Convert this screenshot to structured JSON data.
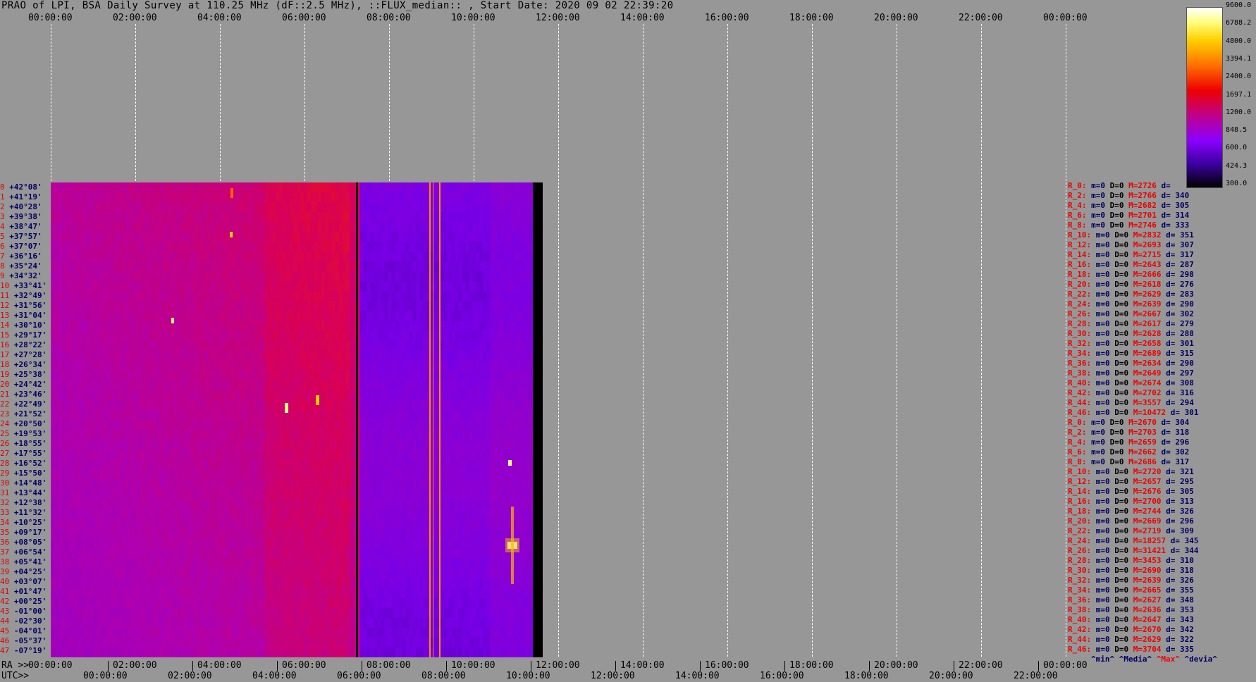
{
  "title": "PRAO of LPI, BSA Daily Survey at 110.25 MHz (dF::2.5 MHz), ::FLUX_median:: , Start Date: 2020 09 02 22:39:20",
  "top_axis_labels": [
    "00:00:00",
    "02:00:00",
    "04:00:00",
    "06:00:00",
    "08:00:00",
    "10:00:00",
    "12:00:00",
    "14:00:00",
    "16:00:00",
    "18:00:00",
    "20:00:00",
    "22:00:00",
    "00:00:00"
  ],
  "ra_prefix": "RA >>",
  "utc_prefix": "UTC>>",
  "ra_axis_labels": [
    "00:00:00",
    "02:00:00",
    "04:00:00",
    "06:00:00",
    "08:00:00",
    "10:00:00",
    "12:00:00",
    "14:00:00",
    "16:00:00",
    "18:00:00",
    "20:00:00",
    "22:00:00",
    "00:00:00"
  ],
  "utc_axis_labels": [
    "00:00:00",
    "02:00:00",
    "04:00:00",
    "06:00:00",
    "08:00:00",
    "10:00:00",
    "12:00:00",
    "14:00:00",
    "16:00:00",
    "18:00:00",
    "20:00:00",
    "22:00:00"
  ],
  "colorbar_ticks": [
    "9600.0",
    "6788.2",
    "4800.0",
    "3394.1",
    "2400.0",
    "1697.1",
    "1200.0",
    "848.5",
    "600.0",
    "424.3",
    "300.0"
  ],
  "legend": {
    "min": "^min^",
    "median": "^Media^",
    "max": "^Max^",
    "dev": "^devia^"
  },
  "declinations": [
    "+42°08'",
    "+41°19'",
    "+40°28'",
    "+39°38'",
    "+38°47'",
    "+37°57'",
    "+37°07'",
    "+36°16'",
    "+35°24'",
    "+34°32'",
    "+33°41'",
    "+32°49'",
    "+31°56'",
    "+31°04'",
    "+30°10'",
    "+29°17'",
    "+28°22'",
    "+27°28'",
    "+26°34'",
    "+25°38'",
    "+24°42'",
    "+23°46'",
    "+22°49'",
    "+21°52'",
    "+20°50'",
    "+19°53'",
    "+18°55'",
    "+17°55'",
    "+16°52'",
    "+15°50'",
    "+14°48'",
    "+13°44'",
    "+12°38'",
    "+11°32'",
    "+10°25'",
    "+09°17'",
    "+08°05'",
    "+06°54'",
    "+05°41'",
    "+04°25'",
    "+03°07'",
    "+01°47'",
    "+00°25'",
    "-01°00'",
    "-02°30'",
    "-04°01'",
    "-05°37'",
    "-07°19'"
  ],
  "stats": [
    {
      "r": "R_0:",
      "m": "m=0",
      "d": "D=0",
      "M": "M=2726",
      "dv": "d="
    },
    {
      "r": "R_2:",
      "m": "m=0",
      "d": "D=0",
      "M": "M=2766",
      "dv": "d= 340"
    },
    {
      "r": "R_4:",
      "m": "m=0",
      "d": "D=0",
      "M": "M=2682",
      "dv": "d= 305"
    },
    {
      "r": "R_6:",
      "m": "m=0",
      "d": "D=0",
      "M": "M=2701",
      "dv": "d= 314"
    },
    {
      "r": "R_8:",
      "m": "m=0",
      "d": "D=0",
      "M": "M=2746",
      "dv": "d= 333"
    },
    {
      "r": "R_10:",
      "m": "m=0",
      "d": "D=0",
      "M": "M=2832",
      "dv": "d= 351"
    },
    {
      "r": "R_12:",
      "m": "m=0",
      "d": "D=0",
      "M": "M=2693",
      "dv": "d= 307"
    },
    {
      "r": "R_14:",
      "m": "m=0",
      "d": "D=0",
      "M": "M=2715",
      "dv": "d= 317"
    },
    {
      "r": "R_16:",
      "m": "m=0",
      "d": "D=0",
      "M": "M=2643",
      "dv": "d= 287"
    },
    {
      "r": "R_18:",
      "m": "m=0",
      "d": "D=0",
      "M": "M=2666",
      "dv": "d= 298"
    },
    {
      "r": "R_20:",
      "m": "m=0",
      "d": "D=0",
      "M": "M=2618",
      "dv": "d= 276"
    },
    {
      "r": "R_22:",
      "m": "m=0",
      "d": "D=0",
      "M": "M=2629",
      "dv": "d= 283"
    },
    {
      "r": "R_24:",
      "m": "m=0",
      "d": "D=0",
      "M": "M=2639",
      "dv": "d= 290"
    },
    {
      "r": "R_26:",
      "m": "m=0",
      "d": "D=0",
      "M": "M=2667",
      "dv": "d= 302"
    },
    {
      "r": "R_28:",
      "m": "m=0",
      "d": "D=0",
      "M": "M=2617",
      "dv": "d= 279"
    },
    {
      "r": "R_30:",
      "m": "m=0",
      "d": "D=0",
      "M": "M=2628",
      "dv": "d= 288"
    },
    {
      "r": "R_32:",
      "m": "m=0",
      "d": "D=0",
      "M": "M=2658",
      "dv": "d= 301"
    },
    {
      "r": "R_34:",
      "m": "m=0",
      "d": "D=0",
      "M": "M=2689",
      "dv": "d= 315"
    },
    {
      "r": "R_36:",
      "m": "m=0",
      "d": "D=0",
      "M": "M=2634",
      "dv": "d= 290"
    },
    {
      "r": "R_38:",
      "m": "m=0",
      "d": "D=0",
      "M": "M=2649",
      "dv": "d= 297"
    },
    {
      "r": "R_40:",
      "m": "m=0",
      "d": "D=0",
      "M": "M=2674",
      "dv": "d= 308"
    },
    {
      "r": "R_42:",
      "m": "m=0",
      "d": "D=0",
      "M": "M=2702",
      "dv": "d= 316"
    },
    {
      "r": "R_44:",
      "m": "m=0",
      "d": "D=0",
      "M": "M=3557",
      "dv": "d= 294"
    },
    {
      "r": "R_46:",
      "m": "m=0",
      "d": "D=0",
      "M": "M=10472",
      "dv": "d= 301"
    },
    {
      "r": "R_0:",
      "m": "m=0",
      "d": "D=0",
      "M": "M=2670",
      "dv": "d= 304"
    },
    {
      "r": "R_2:",
      "m": "m=0",
      "d": "D=0",
      "M": "M=2703",
      "dv": "d= 318"
    },
    {
      "r": "R_4:",
      "m": "m=0",
      "d": "D=0",
      "M": "M=2659",
      "dv": "d= 296"
    },
    {
      "r": "R_6:",
      "m": "m=0",
      "d": "D=0",
      "M": "M=2662",
      "dv": "d= 302"
    },
    {
      "r": "R_8:",
      "m": "m=0",
      "d": "D=0",
      "M": "M=2686",
      "dv": "d= 317"
    },
    {
      "r": "R_10:",
      "m": "m=0",
      "d": "D=0",
      "M": "M=2720",
      "dv": "d= 321"
    },
    {
      "r": "R_12:",
      "m": "m=0",
      "d": "D=0",
      "M": "M=2657",
      "dv": "d= 295"
    },
    {
      "r": "R_14:",
      "m": "m=0",
      "d": "D=0",
      "M": "M=2676",
      "dv": "d= 305"
    },
    {
      "r": "R_16:",
      "m": "m=0",
      "d": "D=0",
      "M": "M=2700",
      "dv": "d= 313"
    },
    {
      "r": "R_18:",
      "m": "m=0",
      "d": "D=0",
      "M": "M=2744",
      "dv": "d= 326"
    },
    {
      "r": "R_20:",
      "m": "m=0",
      "d": "D=0",
      "M": "M=2669",
      "dv": "d= 296"
    },
    {
      "r": "R_22:",
      "m": "m=0",
      "d": "D=0",
      "M": "M=2719",
      "dv": "d= 309"
    },
    {
      "r": "R_24:",
      "m": "m=0",
      "d": "D=0",
      "M": "M=18257",
      "dv": "d= 345"
    },
    {
      "r": "R_26:",
      "m": "m=0",
      "d": "D=0",
      "M": "M=31421",
      "dv": "d= 344"
    },
    {
      "r": "R_28:",
      "m": "m=0",
      "d": "D=0",
      "M": "M=3453",
      "dv": "d= 310"
    },
    {
      "r": "R_30:",
      "m": "m=0",
      "d": "D=0",
      "M": "M=2690",
      "dv": "d= 318"
    },
    {
      "r": "R_32:",
      "m": "m=0",
      "d": "D=0",
      "M": "M=2639",
      "dv": "d= 326"
    },
    {
      "r": "R_34:",
      "m": "m=0",
      "d": "D=0",
      "M": "M=2665",
      "dv": "d= 355"
    },
    {
      "r": "R_36:",
      "m": "m=0",
      "d": "D=0",
      "M": "M=2627",
      "dv": "d= 348"
    },
    {
      "r": "R_38:",
      "m": "m=0",
      "d": "D=0",
      "M": "M=2636",
      "dv": "d= 353"
    },
    {
      "r": "R_40:",
      "m": "m=0",
      "d": "D=0",
      "M": "M=2647",
      "dv": "d= 343"
    },
    {
      "r": "R_42:",
      "m": "m=0",
      "d": "D=0",
      "M": "M=2670",
      "dv": "d= 342"
    },
    {
      "r": "R_44:",
      "m": "m=0",
      "d": "D=0",
      "M": "M=2629",
      "dv": "d= 322"
    },
    {
      "r": "R_46:",
      "m": "m=0",
      "d": "D=0",
      "M": "M=3704",
      "dv": "d= 335"
    }
  ],
  "chart_data": {
    "type": "heatmap",
    "title": "PRAO of LPI, BSA Daily Survey at 110.25 MHz (dF::2.5 MHz), ::FLUX_median:: , Start Date: 2020 09 02 22:39:20",
    "x_unit": "RA / UTC time (hh:mm:ss)",
    "x_range": [
      "00:00:00",
      "24:00:00"
    ],
    "data_coverage": [
      "00:00:00",
      "11:50:00"
    ],
    "rows": 48,
    "color_scale": {
      "min": 300.0,
      "max": 9600.0,
      "scale": "log",
      "colors": [
        "#000000",
        "#3a00a0",
        "#8a00ff",
        "#c0008a",
        "#ee0000",
        "#ff7000",
        "#ffd000",
        "#ffff80",
        "#ffffff"
      ]
    },
    "bright_sources": [
      {
        "ra": "10:45",
        "dec": "+08°05'",
        "level": "saturated"
      },
      {
        "ra": "05:50",
        "dec": "+21°52'",
        "level": "high"
      },
      {
        "ra": "06:30",
        "dec": "+22°49'",
        "level": "high"
      },
      {
        "ra": "10:45",
        "dec": "+16°52'",
        "level": "high"
      }
    ],
    "gap_rows_ra": [
      "07:15"
    ]
  }
}
